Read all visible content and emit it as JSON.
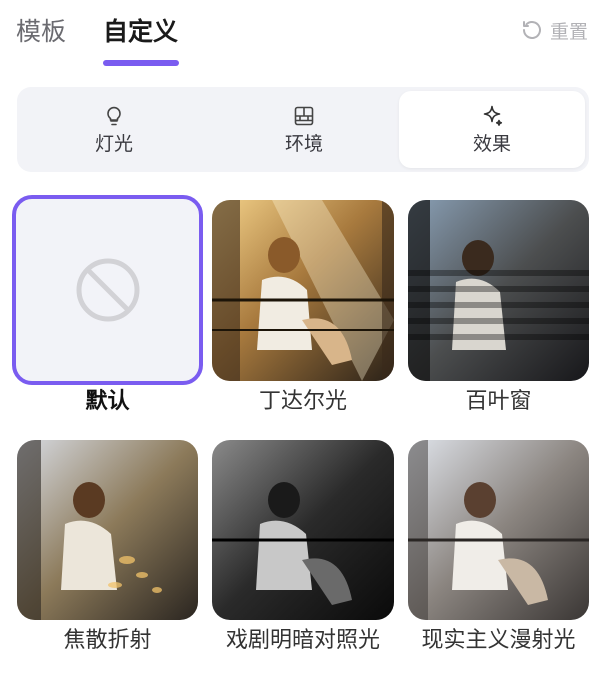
{
  "header": {
    "tabs": [
      {
        "label": "模板",
        "active": false
      },
      {
        "label": "自定义",
        "active": true
      }
    ],
    "reset_label": "重置",
    "accent_color": "#7a5cf0"
  },
  "segments": [
    {
      "label": "灯光",
      "icon": "lightbulb-icon",
      "active": false
    },
    {
      "label": "环境",
      "icon": "building-icon",
      "active": false
    },
    {
      "label": "效果",
      "icon": "sparkle-icon",
      "active": true
    }
  ],
  "effects": [
    {
      "label": "默认",
      "icon": "no-effect-icon",
      "selected": true
    },
    {
      "label": "丁达尔光",
      "selected": false
    },
    {
      "label": "百叶窗",
      "selected": false
    },
    {
      "label": "焦散折射",
      "selected": false
    },
    {
      "label": "戏剧明暗对照光",
      "selected": false
    },
    {
      "label": "现实主义漫射光",
      "selected": false
    }
  ]
}
